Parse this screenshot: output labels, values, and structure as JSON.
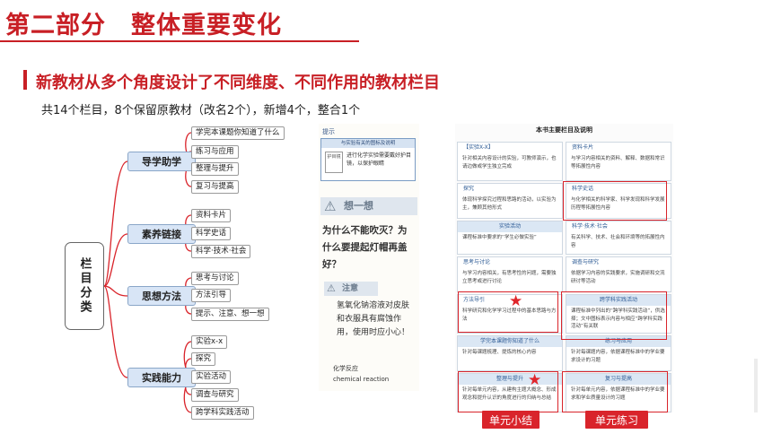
{
  "header": {
    "title": "第二部分　整体重要变化",
    "subtitle": "新教材从多个角度设计了不同维度、不同作用的教材栏目",
    "summary": "共14个栏目，8个保留原教材（改名2个），新增4个，整合1个"
  },
  "mindmap": {
    "root": "栏目分类",
    "categories": [
      {
        "label": "导学助学",
        "items": [
          "学完本课题你知道了什么",
          "练习与应用",
          "整理与提升",
          "复习与提高"
        ]
      },
      {
        "label": "素养链接",
        "items": [
          "资料卡片",
          "科学史话",
          "科学·技术·社会"
        ]
      },
      {
        "label": "思想方法",
        "items": [
          "思考与讨论",
          "方法引导",
          "提示、注意、想一想"
        ]
      },
      {
        "label": "实践能力",
        "items": [
          "实验x-x",
          "探究",
          "实验活动",
          "调查与研究",
          "跨学科实践活动"
        ]
      }
    ]
  },
  "textbook": {
    "tip_head": "提示",
    "tip_box_head": "与实验有关的图标及说明",
    "tip_box_icon": "护目镜",
    "tip_box_text": "进行化学实验需要戴好护目镜，以保护眼睛",
    "think_label": "想一想",
    "think_text": "为什么不能吹灭？为什么要提起灯帽再盖好？",
    "note_label": "注意",
    "note_text": "氢氧化钠溶液对皮肤和衣服具有腐蚀作用，使用时应小心！",
    "term_cn": "化学反应",
    "term_en": "chemical reaction"
  },
  "columns_table": {
    "title": "本书主要栏目及说明",
    "left": [
      {
        "head": "【实验X-X】",
        "body": "针对相关内容设计的实验，可教师演示，也请边做或学生独立完成"
      },
      {
        "head": "探究",
        "body": "体现科学探究过程和思路的活动，以实验为主，兼顾其他形式"
      },
      {
        "head": "实验活动",
        "body": "课程标准中要求的“学生必做实验”"
      },
      {
        "head": "思考与讨论",
        "body": "与学习内容相关，有思考性的问题，需要独立思考或进行讨论"
      },
      {
        "head": "方法导引",
        "body": "科学研究和化学学习过程中的基本思路与方法"
      },
      {
        "head": "学完本课题你知道了什么",
        "body": "针对每课题梳理、提炼的核心内容"
      },
      {
        "head": "整理与提升",
        "body": "针对每单元内容，从建构主题大概念、形成观念和提升认识的角度进行的归纳与总结"
      }
    ],
    "right": [
      {
        "head": "资料卡片",
        "body": "与学习内容相关的资料、解释、数据和常识等拓展性内容"
      },
      {
        "head": "科学史话",
        "body": "与化学相关的科学家、科学发现和科学发展历程等拓展性内容"
      },
      {
        "head": "科学·技术·社会",
        "body": "有关科学、技术、社会和环境等的拓展性内容"
      },
      {
        "head": "调查与研究",
        "body": "依据学习内容的实践要求，实施调研和交流研讨等活动"
      },
      {
        "head": "跨学科实践活动",
        "body": "课程标准中列出的“跨学科实践活动”，供选择；文中图标表示内容与相应“跨学科实践活动”有关联"
      },
      {
        "head": "练习与应用",
        "body": "针对每课题内容，依据课程标准中的学业要求设计的习题"
      },
      {
        "head": "复习与提高",
        "body": "针对每单元内容，依据课程标准中的学业要求和学业质量设计的习题"
      }
    ],
    "label_unit_summary": "单元小结",
    "label_unit_practice": "单元练习",
    "star_glyph": "★"
  },
  "colors": {
    "accent": "#c81f25",
    "category_fill": "#d8e5f6",
    "highlight": "#d9242b"
  }
}
